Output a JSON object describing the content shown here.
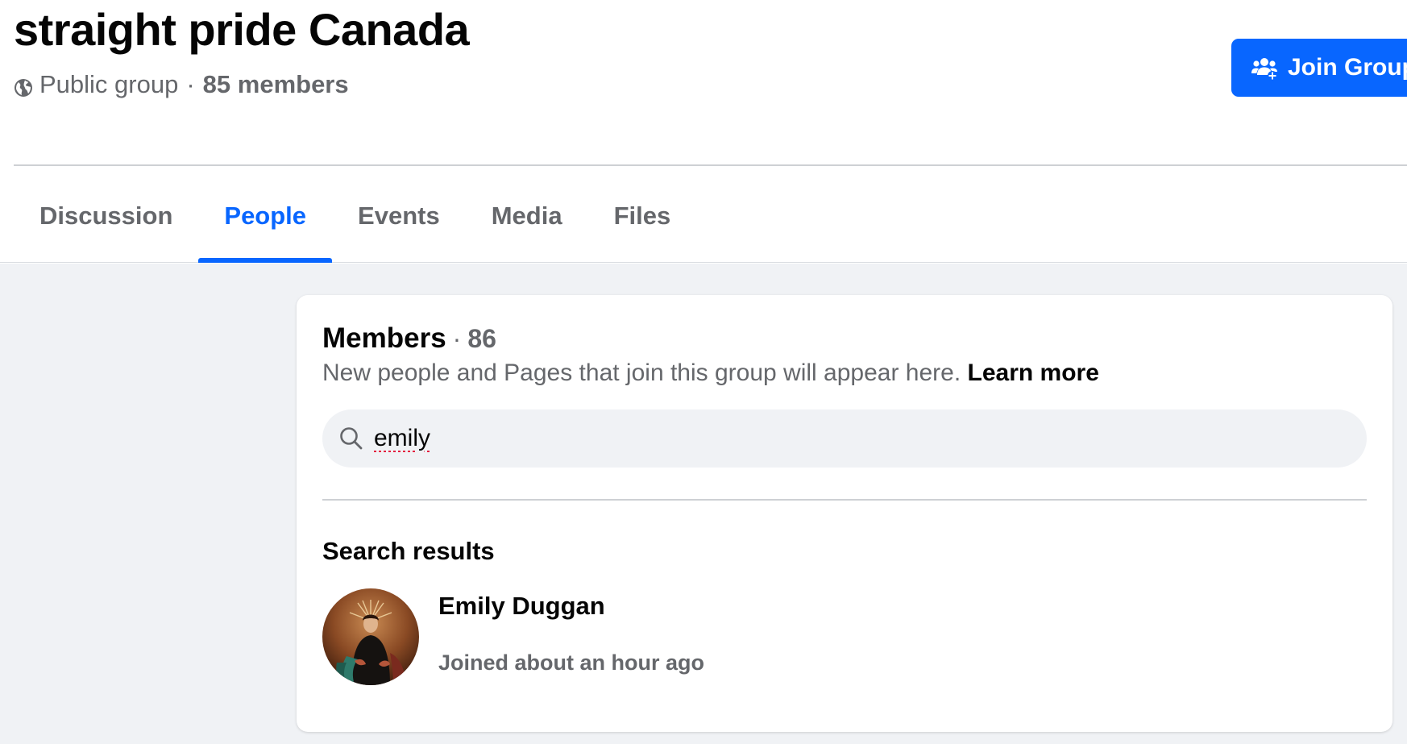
{
  "group": {
    "name": "straight pride Canada",
    "privacy": "Public group",
    "separator": "·",
    "member_count_label": "85 members",
    "join_button_label": "Join Group",
    "icons": {
      "privacy": "globe-icon",
      "join": "people-add-icon"
    }
  },
  "tabs": [
    {
      "label": "Discussion",
      "active": false
    },
    {
      "label": "People",
      "active": true
    },
    {
      "label": "Events",
      "active": false
    },
    {
      "label": "Media",
      "active": false
    },
    {
      "label": "Files",
      "active": false
    }
  ],
  "members": {
    "title": "Members",
    "separator": "·",
    "count": "86",
    "description": "New people and Pages that join this group will appear here.",
    "learn_more": "Learn more",
    "search": {
      "value": "emily",
      "icon": "search-icon"
    },
    "results_heading": "Search results",
    "results": [
      {
        "name": "Emily Duggan",
        "joined": "Joined about an hour ago",
        "avatar": "avatar"
      }
    ]
  },
  "colors": {
    "accent": "#0866ff",
    "text_primary": "#050505",
    "text_secondary": "#65676b",
    "page_background": "#f0f2f5",
    "spellcheck_underline": "#e41e3f"
  }
}
